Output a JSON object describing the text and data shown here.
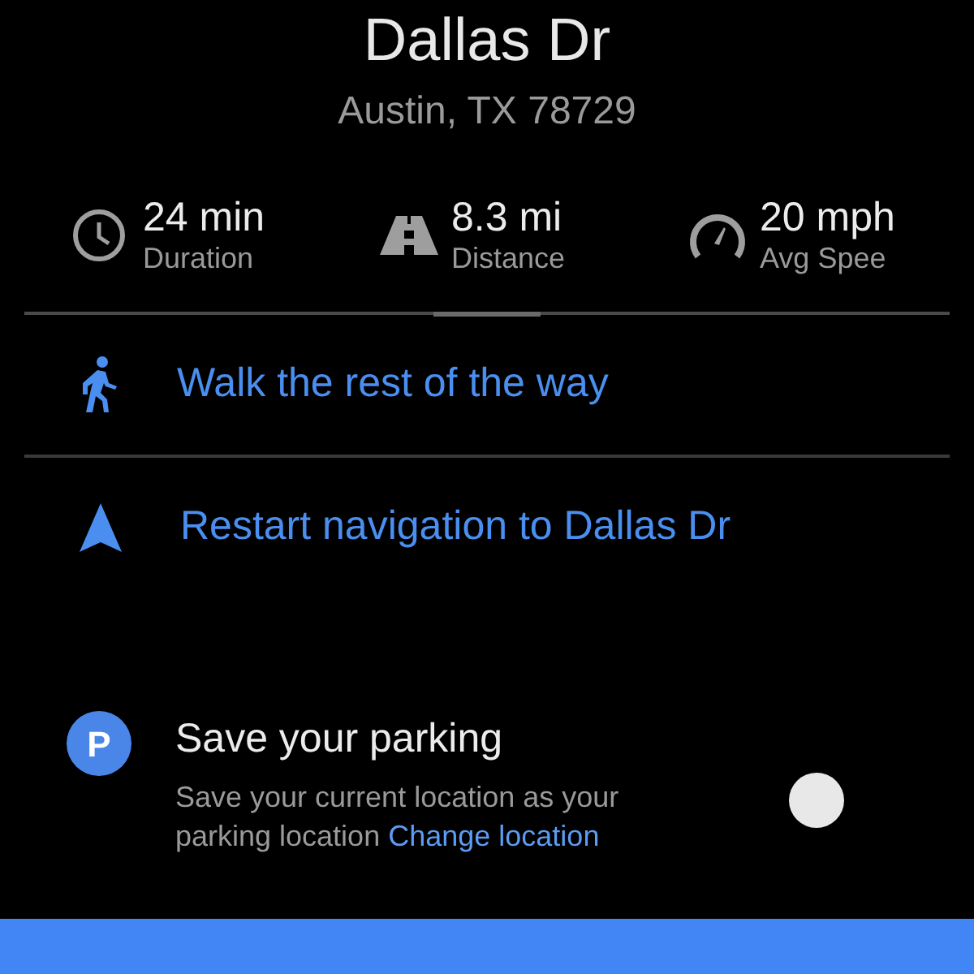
{
  "destination": {
    "title": "Dallas Dr",
    "address": "Austin, TX 78729"
  },
  "stats": [
    {
      "kind": "clock",
      "value": "24 min",
      "label": "Duration"
    },
    {
      "kind": "road",
      "value": "8.3 mi",
      "label": "Distance"
    },
    {
      "kind": "speed",
      "value": "20 mph",
      "label": "Avg Spee"
    }
  ],
  "actions": [
    {
      "kind": "walk",
      "label": "Walk the rest of the way"
    },
    {
      "kind": "navigate",
      "label": "Restart navigation to Dallas Dr"
    }
  ],
  "parking": {
    "badge": "P",
    "title": "Save your parking",
    "description": "Save your current location as your parking location",
    "link": "Change location",
    "toggle": {
      "on": false
    }
  }
}
